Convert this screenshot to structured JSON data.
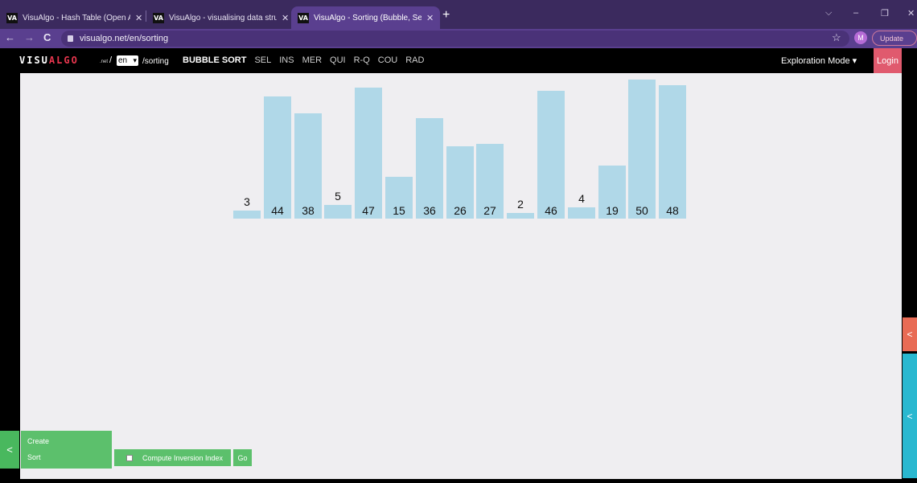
{
  "browser": {
    "tabs": [
      {
        "favicon": "VA",
        "title": "VisuAlgo - Hash Table (Open Add",
        "active": false
      },
      {
        "favicon": "VA",
        "title": "VisuAlgo - visualising data struct",
        "active": false
      },
      {
        "favicon": "VA",
        "title": "VisuAlgo - Sorting (Bubble, Selec",
        "active": true
      }
    ],
    "new_tab": "+",
    "close": "✕",
    "url": "visualgo.net/en/sorting",
    "back": "←",
    "forward": "→",
    "reload": "C",
    "star": "☆",
    "avatar_letter": "M",
    "update_label": "Update",
    "window_controls": [
      "⌵",
      "–",
      "❐",
      "✕"
    ]
  },
  "site": {
    "logo_left": "VISU",
    "logo_right": "ALGO",
    "logo_suffix": ".net",
    "slash": "/",
    "language": "en",
    "path": "/sorting",
    "algorithms": [
      {
        "label": "BUBBLE SORT",
        "active": true
      },
      {
        "label": "SEL",
        "active": false
      },
      {
        "label": "INS",
        "active": false
      },
      {
        "label": "MER",
        "active": false
      },
      {
        "label": "QUI",
        "active": false
      },
      {
        "label": "R-Q",
        "active": false
      },
      {
        "label": "COU",
        "active": false
      },
      {
        "label": "RAD",
        "active": false
      }
    ],
    "mode": "Exploration Mode ▾",
    "login": "Login"
  },
  "array": {
    "values": [
      3,
      44,
      38,
      5,
      47,
      15,
      36,
      26,
      27,
      2,
      46,
      4,
      19,
      50,
      48
    ],
    "max_value": 50,
    "bar_color": "#b0d8e8"
  },
  "controls": {
    "create": "Create",
    "sort": "Sort",
    "compute_inversion": "Compute Inversion Index",
    "go": "Go",
    "collapse_arrow": "<"
  }
}
